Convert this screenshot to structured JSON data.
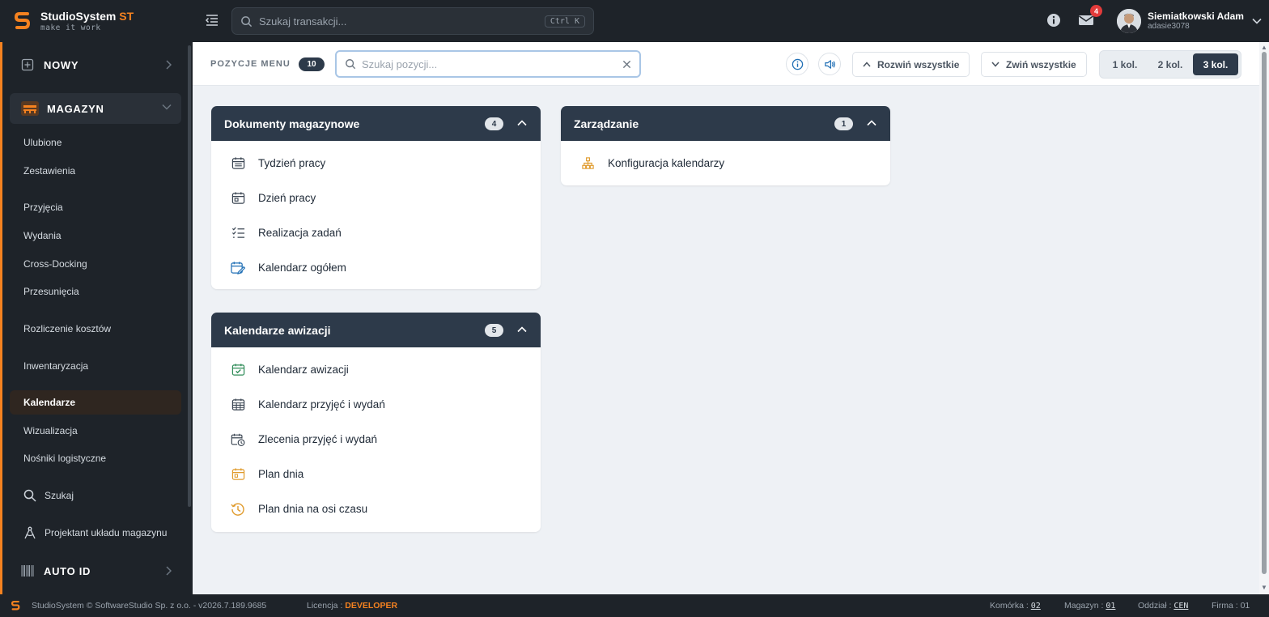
{
  "app": {
    "brand_name": "StudioSystem",
    "brand_suffix": "ST",
    "brand_tagline": "make it work"
  },
  "topbar": {
    "search_placeholder": "Szukaj transakcji...",
    "search_shortcut": "Ctrl K",
    "mail_count": "4",
    "user_name": "Siemiatkowski Adam",
    "user_login": "adasie3078"
  },
  "sidebar": {
    "sections": [
      {
        "label": "NOWY"
      },
      {
        "label": "MAGAZYN"
      },
      {
        "label": "AUTO ID"
      }
    ],
    "items": [
      {
        "label": "Ulubione"
      },
      {
        "label": "Zestawienia"
      },
      {
        "label": "Przyjęcia"
      },
      {
        "label": "Wydania"
      },
      {
        "label": "Cross-Docking"
      },
      {
        "label": "Przesunięcia"
      },
      {
        "label": "Rozliczenie kosztów"
      },
      {
        "label": "Inwentaryzacja"
      },
      {
        "label": "Kalendarze"
      },
      {
        "label": "Wizualizacja"
      },
      {
        "label": "Nośniki logistyczne"
      },
      {
        "label": "Szukaj"
      },
      {
        "label": "Projektant układu magazynu"
      }
    ],
    "active_item": "Kalendarze"
  },
  "toolbar": {
    "title": "POZYCJE MENU",
    "count": "10",
    "search_placeholder": "Szukaj pozycji...",
    "expand_label": "Rozwiń wszystkie",
    "collapse_label": "Zwiń wszystkie",
    "columns": [
      "1 kol.",
      "2 kol.",
      "3 kol."
    ],
    "active_column": "3 kol."
  },
  "groups": [
    {
      "title": "Dokumenty magazynowe",
      "count": "4",
      "items": [
        {
          "label": "Tydzień pracy",
          "icon": "calendar-week-icon"
        },
        {
          "label": "Dzień pracy",
          "icon": "calendar-day-icon"
        },
        {
          "label": "Realizacja zadań",
          "icon": "task-list-icon"
        },
        {
          "label": "Kalendarz ogółem",
          "icon": "calendar-edit-icon"
        }
      ]
    },
    {
      "title": "Zarządzanie",
      "count": "1",
      "items": [
        {
          "label": "Konfiguracja kalendarzy",
          "icon": "hierarchy-icon"
        }
      ]
    },
    {
      "title": "Kalendarze awizacji",
      "count": "5",
      "items": [
        {
          "label": "Kalendarz awizacji",
          "icon": "calendar-check-icon"
        },
        {
          "label": "Kalendarz przyjęć i wydań",
          "icon": "calendar-grid-icon"
        },
        {
          "label": "Zlecenia przyjęć i wydań",
          "icon": "calendar-clock-icon"
        },
        {
          "label": "Plan dnia",
          "icon": "calendar-plan-icon"
        },
        {
          "label": "Plan dnia na osi czasu",
          "icon": "history-icon"
        }
      ]
    }
  ],
  "footer": {
    "copyright": "StudioSystem © SoftwareStudio Sp. z o.o. - v2026.7.189.9685",
    "license_label": "Licencja :",
    "license_value": "DEVELOPER",
    "cell_label": "Komórka :",
    "cell_value": "02",
    "warehouse_label": "Magazyn :",
    "warehouse_value": "01",
    "branch_label": "Oddział :",
    "branch_value": "CEN",
    "company_label": "Firma :",
    "company_value": "01"
  },
  "colors": {
    "accent": "#f58220",
    "dark": "#1e2329",
    "card_header": "#2d3a4a"
  }
}
